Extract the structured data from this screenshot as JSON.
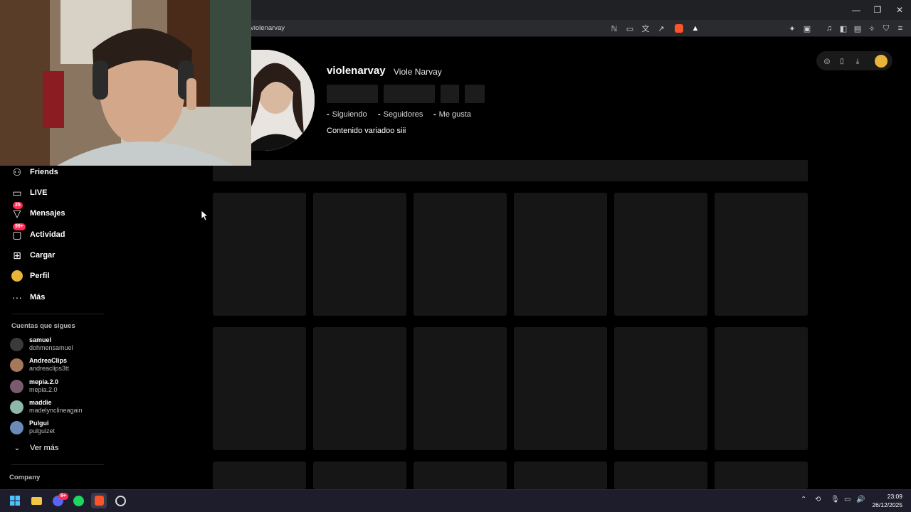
{
  "window": {
    "minimize": "—",
    "restore": "❐",
    "close": "✕"
  },
  "browser": {
    "url": "violenarvay"
  },
  "profile": {
    "username": "violenarvay",
    "display_name": "Viole Narvay",
    "stats": [
      {
        "value": "-",
        "label": "Siguiendo"
      },
      {
        "value": "-",
        "label": "Seguidores"
      },
      {
        "value": "-",
        "label": "Me gusta"
      }
    ],
    "bio": "Contenido variadoo siii"
  },
  "sidebar": {
    "items": [
      {
        "label": "Friends",
        "icon": "friends-icon"
      },
      {
        "label": "LIVE",
        "icon": "live-icon"
      },
      {
        "label": "Mensajes",
        "icon": "messages-icon",
        "badge": "25"
      },
      {
        "label": "Actividad",
        "icon": "activity-icon",
        "badge": "99+"
      },
      {
        "label": "Cargar",
        "icon": "upload-icon"
      },
      {
        "label": "Perfil",
        "icon": "profile-avatar-icon"
      },
      {
        "label": "Más",
        "icon": "more-icon"
      }
    ],
    "following_title": "Cuentas que sigues",
    "accounts": [
      {
        "name": "samuel",
        "handle": "dohmensamuel"
      },
      {
        "name": "AndreaClips",
        "handle": "andreaclips3tt"
      },
      {
        "name": "mepia.2.0",
        "handle": "mepia.2.0"
      },
      {
        "name": "maddie",
        "handle": "madelynclineagain"
      },
      {
        "name": "Pulgui",
        "handle": "pulguizet"
      }
    ],
    "see_more": "Ver más",
    "company": "Company"
  },
  "taskbar": {
    "discord_badge": "9+",
    "time": "23:09",
    "date": "26/12/2025"
  },
  "colors": {
    "accent": "#fe2c55",
    "background": "#000000",
    "skeleton": "#161616"
  }
}
